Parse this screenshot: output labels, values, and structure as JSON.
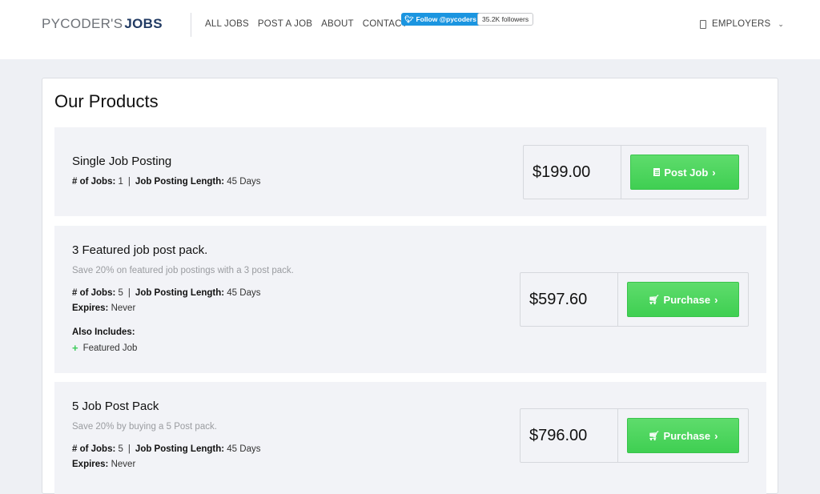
{
  "header": {
    "logo_part1": "PYCODER'S",
    "logo_part2": "JOBS",
    "nav": [
      "ALL JOBS",
      "POST A JOB",
      "ABOUT",
      "CONTACT"
    ],
    "twitter_follow": "Follow @pycoders",
    "twitter_followers": "35.2K followers",
    "employers_label": "EMPLOYERS"
  },
  "page_title": "Our Products",
  "products": [
    {
      "title": "Single Job Posting",
      "jobs_label": "# of Jobs:",
      "jobs_value": "1",
      "length_label": "Job Posting Length:",
      "length_value": "45 Days",
      "price": "$199.00",
      "button_label": "Post Job"
    },
    {
      "title": "3 Featured job post pack.",
      "subtitle": "Save 20% on featured job postings with a 3 post pack.",
      "jobs_label": "# of Jobs:",
      "jobs_value": "5",
      "length_label": "Job Posting Length:",
      "length_value": "45 Days",
      "expires_label": "Expires:",
      "expires_value": "Never",
      "also_label": "Also Includes:",
      "feature": "Featured Job",
      "price": "$597.60",
      "button_label": "Purchase"
    },
    {
      "title": "5 Job Post Pack",
      "subtitle": "Save 20% by buying a 5 Post pack.",
      "jobs_label": "# of Jobs:",
      "jobs_value": "5",
      "length_label": "Job Posting Length:",
      "length_value": "45 Days",
      "expires_label": "Expires:",
      "expires_value": "Never",
      "price": "$796.00",
      "button_label": "Purchase"
    }
  ],
  "colors": {
    "accent_green": "#4cd45e",
    "twitter_blue": "#1b95e0",
    "brand_navy": "#223b63"
  }
}
